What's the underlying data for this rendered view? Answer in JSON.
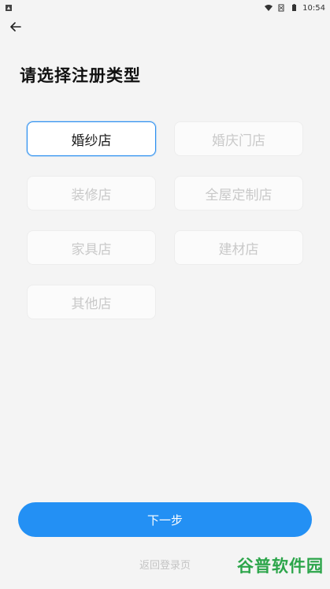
{
  "status_bar": {
    "time": "10:54"
  },
  "title": "请选择注册类型",
  "options": [
    {
      "label": "婚纱店"
    },
    {
      "label": "婚庆门店"
    },
    {
      "label": "装修店"
    },
    {
      "label": "全屋定制店"
    },
    {
      "label": "家具店"
    },
    {
      "label": "建材店"
    },
    {
      "label": "其他店"
    }
  ],
  "selected_index": 0,
  "next_button": {
    "label": "下一步"
  },
  "back_to_login": {
    "label": "返回登录页"
  },
  "watermark": {
    "part1": "谷普",
    "part2": "软件园"
  },
  "colors": {
    "accent": "#2390f4",
    "selected_border": "#2b8ff0",
    "watermark": "#2ca54a"
  }
}
